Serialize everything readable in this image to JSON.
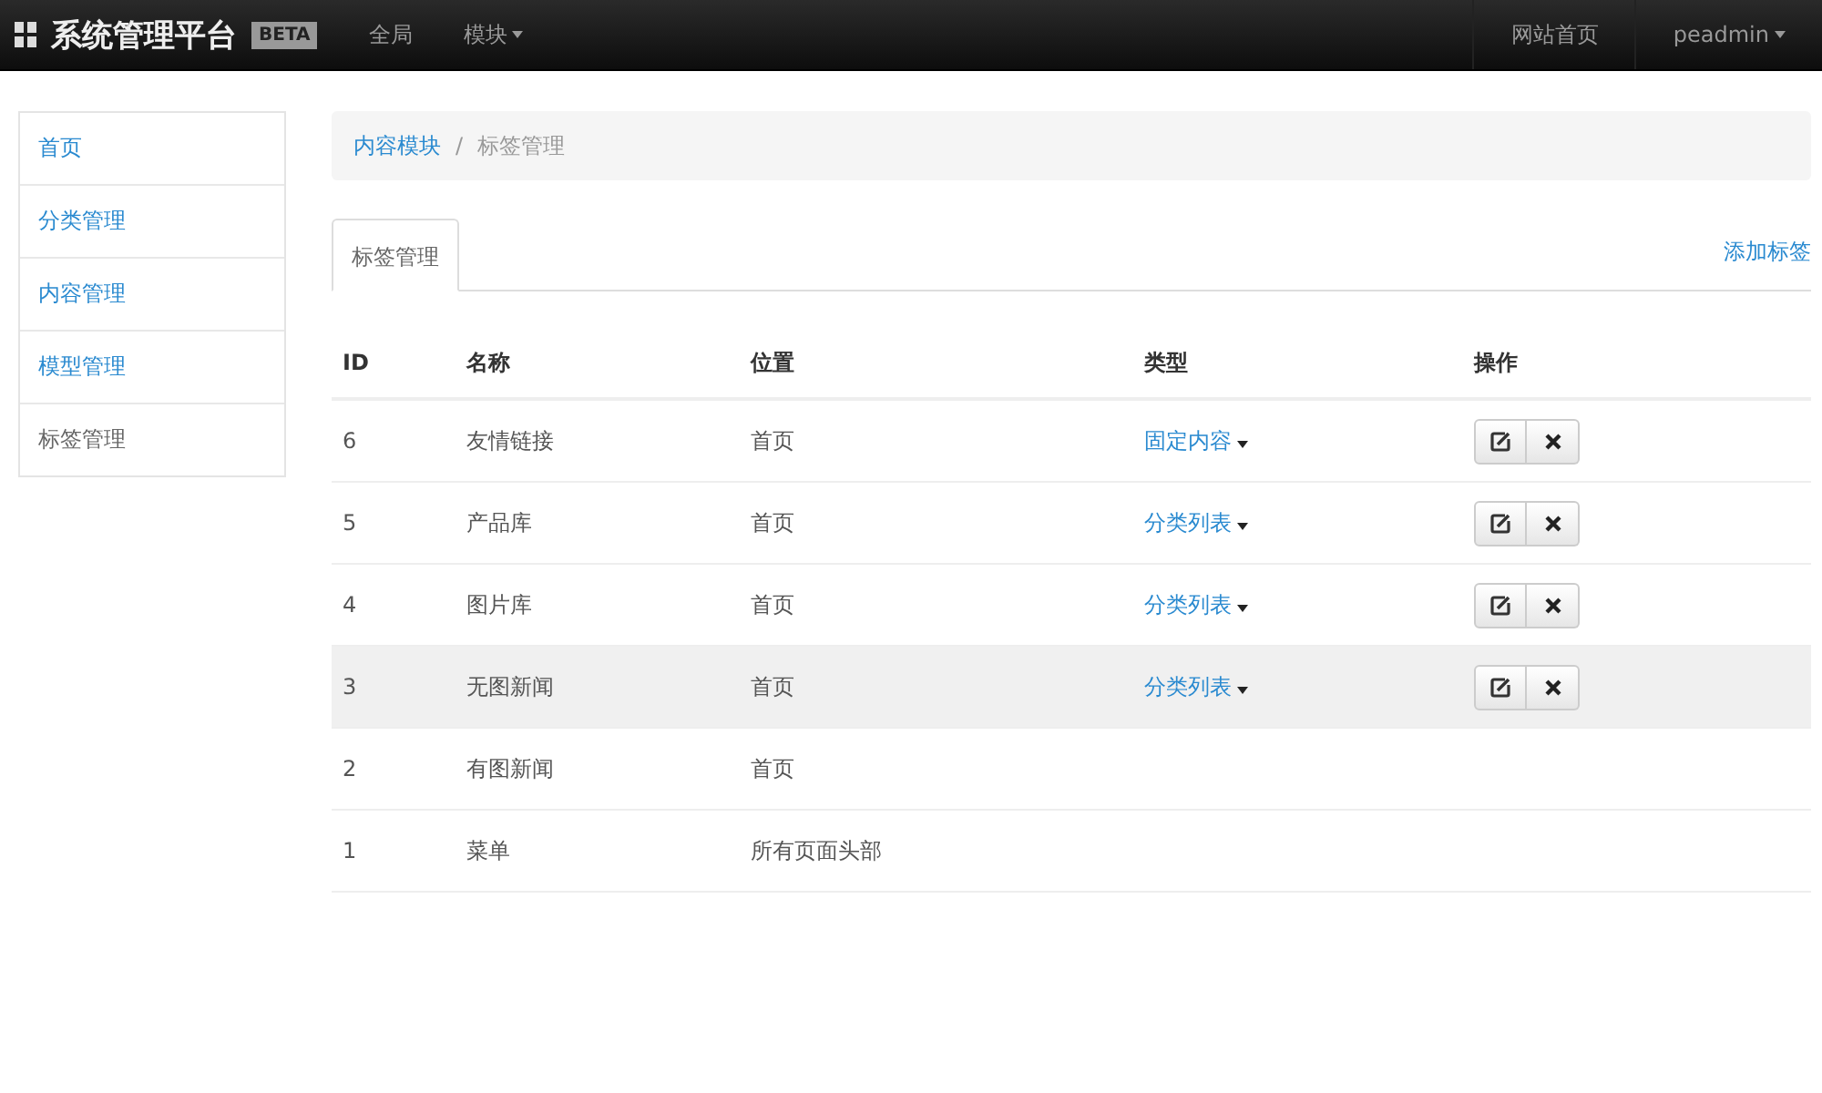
{
  "navbar": {
    "brand": "系统管理平台",
    "badge": "BETA",
    "links": [
      {
        "label": "全局",
        "dropdown": false
      },
      {
        "label": "模块",
        "dropdown": true
      }
    ],
    "right_links": [
      {
        "label": "网站首页",
        "dropdown": false
      },
      {
        "label": "peadmin",
        "dropdown": true
      }
    ]
  },
  "sidebar": {
    "items": [
      {
        "label": "首页",
        "selected": false
      },
      {
        "label": "分类管理",
        "selected": false
      },
      {
        "label": "内容管理",
        "selected": false
      },
      {
        "label": "模型管理",
        "selected": false
      },
      {
        "label": "标签管理",
        "selected": true
      }
    ]
  },
  "breadcrumb_separator": "/",
  "breadcrumb": [
    {
      "label": "内容模块",
      "link": true
    },
    {
      "label": "标签管理",
      "link": false
    }
  ],
  "tabs": [
    {
      "label": "标签管理",
      "selected": true
    }
  ],
  "add_link": "添加标签",
  "table": {
    "columns": [
      "ID",
      "名称",
      "位置",
      "类型",
      "操作"
    ],
    "rows": [
      {
        "id": "6",
        "name": "友情链接",
        "position": "首页",
        "type": "固定内容",
        "actions": true,
        "highlighted": false
      },
      {
        "id": "5",
        "name": "产品库",
        "position": "首页",
        "type": "分类列表",
        "actions": true,
        "highlighted": false
      },
      {
        "id": "4",
        "name": "图片库",
        "position": "首页",
        "type": "分类列表",
        "actions": true,
        "highlighted": false
      },
      {
        "id": "3",
        "name": "无图新闻",
        "position": "首页",
        "type": "分类列表",
        "actions": true,
        "highlighted": true
      },
      {
        "id": "2",
        "name": "有图新闻",
        "position": "首页",
        "actions": false,
        "highlighted": false
      },
      {
        "id": "1",
        "name": "菜单",
        "position": "所有页面头部",
        "actions": false,
        "highlighted": false
      }
    ]
  }
}
